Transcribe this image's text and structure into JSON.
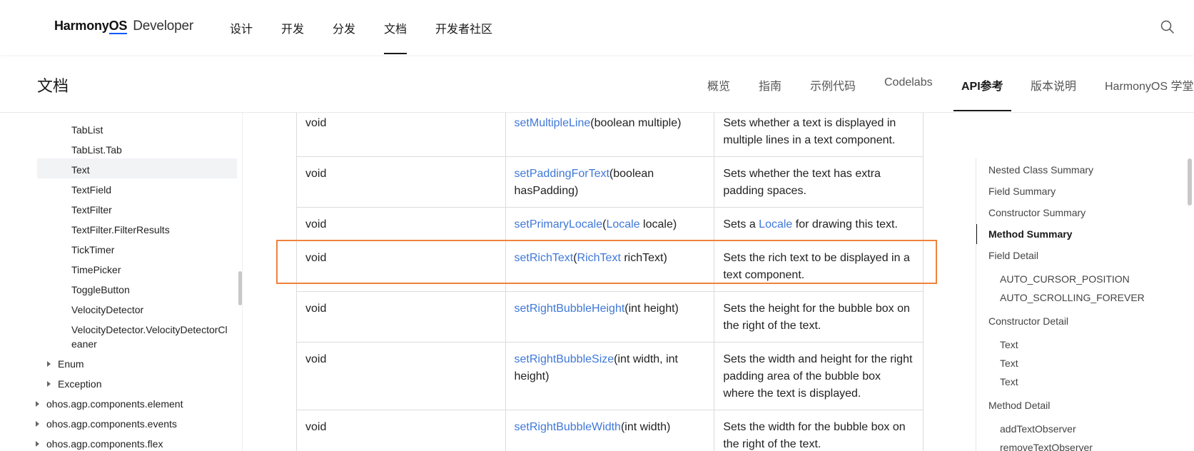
{
  "header": {
    "logo_brand_pre": "Harmony",
    "logo_brand_os": "OS",
    "logo_developer": "Developer",
    "nav": [
      "设计",
      "开发",
      "分发",
      "文档",
      "开发者社区"
    ],
    "active_nav": "文档",
    "search_icon": "search-icon"
  },
  "subheader": {
    "title": "文档",
    "tabs": [
      "概览",
      "指南",
      "示例代码",
      "Codelabs",
      "API参考",
      "版本说明",
      "HarmonyOS 学堂"
    ],
    "active_tab": "API参考"
  },
  "sidebar": {
    "items": [
      "TabList",
      "TabList.Tab",
      "Text",
      "TextField",
      "TextFilter",
      "TextFilter.FilterResults",
      "TickTimer",
      "TimePicker",
      "ToggleButton",
      "VelocityDetector",
      "VelocityDetector.VelocityDetectorCl",
      "eaner"
    ],
    "selected": "Text",
    "groups": [
      "Enum",
      "Exception"
    ],
    "packages": [
      "ohos.agp.components.element",
      "ohos.agp.components.events",
      "ohos.agp.components.flex"
    ]
  },
  "table": {
    "rows": [
      {
        "type": "void",
        "method": "setMultipleLine",
        "args_pre": "(boolean multiple)",
        "arg_link": "",
        "args_post": "",
        "desc_pre": "Sets whether a text is displayed in multiple lines in a text component.",
        "desc_link": "",
        "desc_post": ""
      },
      {
        "type": "void",
        "method": "setPaddingForText",
        "args_pre": "(boolean hasPadding)",
        "arg_link": "",
        "args_post": "",
        "desc_pre": "Sets whether the text has extra padding spaces.",
        "desc_link": "",
        "desc_post": ""
      },
      {
        "type": "void",
        "method": "setPrimaryLocale",
        "args_pre": "(",
        "arg_link": "Locale",
        "args_post": " locale)",
        "desc_pre": "Sets a ",
        "desc_link": "Locale",
        "desc_post": " for drawing this text."
      },
      {
        "type": "void",
        "method": "setRichText",
        "args_pre": "(",
        "arg_link": "RichText",
        "args_post": " richText)",
        "desc_pre": "Sets the rich text to be displayed in a text component.",
        "desc_link": "",
        "desc_post": ""
      },
      {
        "type": "void",
        "method": "setRightBubbleHeight",
        "args_pre": "(int height)",
        "arg_link": "",
        "args_post": "",
        "desc_pre": "Sets the height for the bubble box on the right of the text.",
        "desc_link": "",
        "desc_post": ""
      },
      {
        "type": "void",
        "method": "setRightBubbleSize",
        "args_pre": "(int width, int height)",
        "arg_link": "",
        "args_post": "",
        "desc_pre": "Sets the width and height for the right padding area of the bubble box where the text is displayed.",
        "desc_link": "",
        "desc_post": ""
      },
      {
        "type": "void",
        "method": "setRightBubbleWidth",
        "args_pre": "(int width)",
        "arg_link": "",
        "args_post": "",
        "desc_pre": "Sets the width for the bubble box on the right of the text.",
        "desc_link": "",
        "desc_post": ""
      }
    ]
  },
  "toc": {
    "items": [
      "Nested Class Summary",
      "Field Summary",
      "Constructor Summary",
      "Method Summary",
      "Field Detail",
      "AUTO_CURSOR_POSITION",
      "AUTO_SCROLLING_FOREVER",
      "Constructor Detail",
      "Text",
      "Text",
      "Text",
      "Method Detail",
      "addTextObserver",
      "removeTextObserver"
    ],
    "active": "Method Summary"
  },
  "colors": {
    "link": "#3f78d8",
    "highlight": "#f0823c",
    "brand_underline": "#0a59f7"
  }
}
